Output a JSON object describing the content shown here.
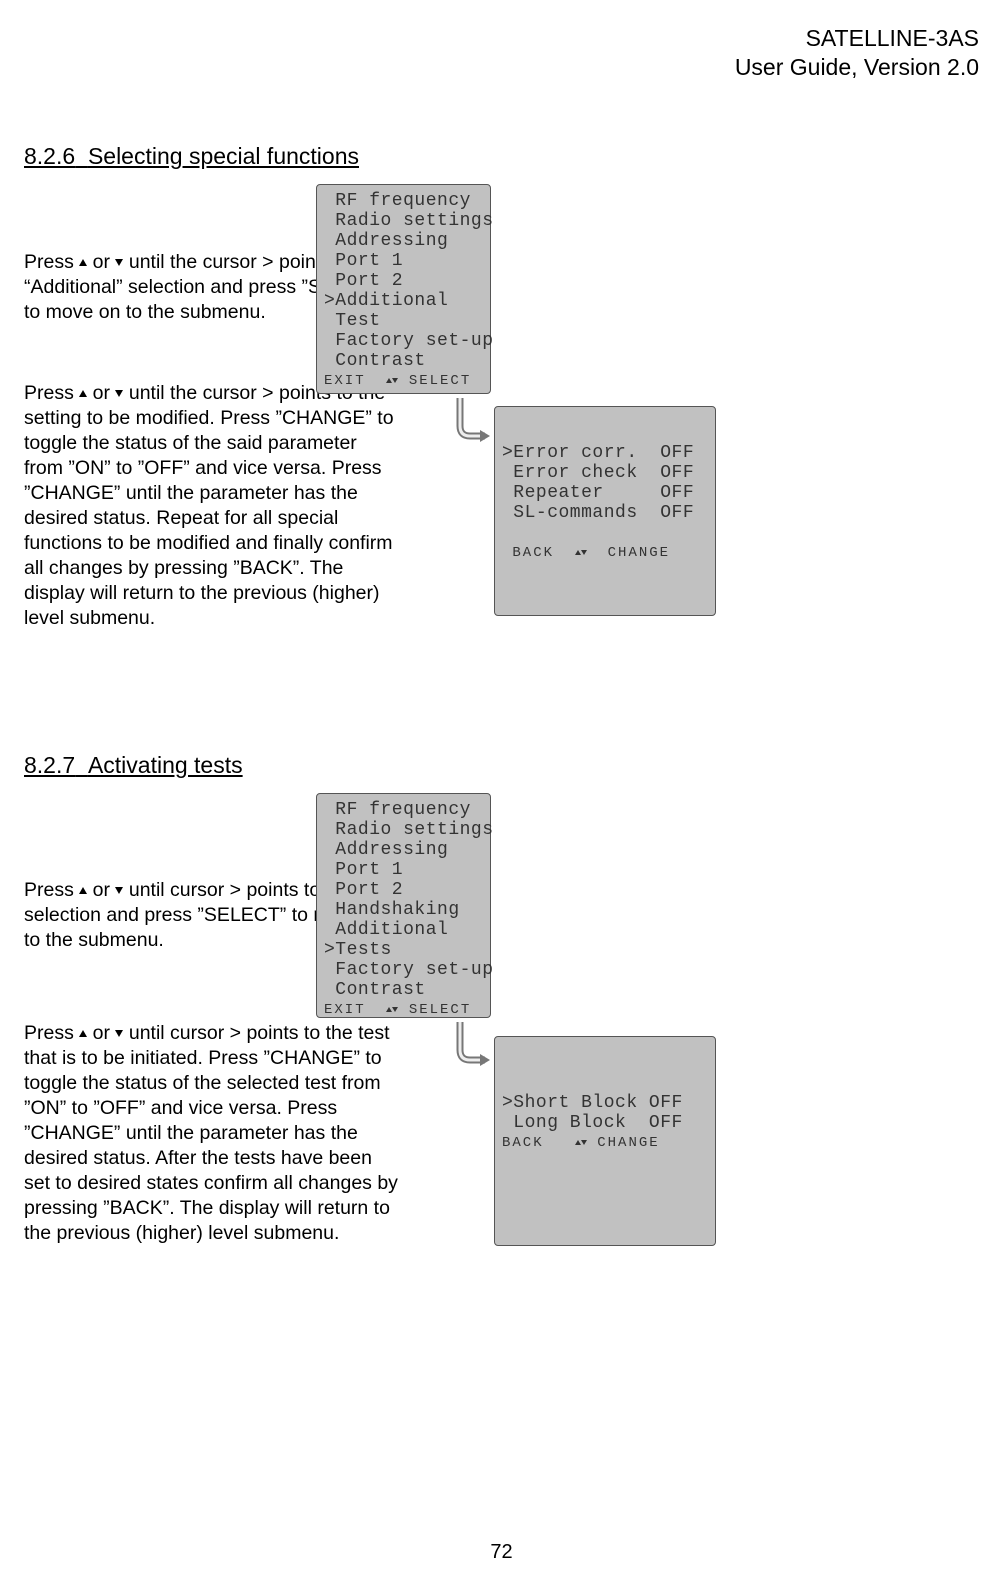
{
  "header": {
    "line1": "SATELLINE-3AS",
    "line2": "User Guide, Version 2.0"
  },
  "sections": {
    "s1": {
      "num": "8.2.6",
      "title": "Selecting special functions"
    },
    "s2": {
      "num": "8.2.7",
      "title": "Activating tests"
    }
  },
  "paragraphs": {
    "t1a": "Press ",
    "t1b": " or ",
    "t1c": " until the cursor > points to “Additional” selection and press ”SELECT” to move on to the submenu.",
    "t2a": "Press ",
    "t2b": " or ",
    "t2c": " until the cursor > points to the setting to be modified. Press ”CHANGE” to toggle the status of the said parameter from ”ON” to ”OFF” and vice versa. Press ”CHANGE” until the parameter has the desired status. Repeat for all special functions to be modified and finally confirm all changes by pressing ”BACK”. The display will return to the previous (higher) level submenu.",
    "t3a": "Press ",
    "t3b": " or ",
    "t3c": " until cursor > points to “Tests” selection and press ”SELECT” to move on to the submenu.",
    "t4a": "Press ",
    "t4b": " or ",
    "t4c": " until cursor > points to the test that is to be initiated. Press ”CHANGE” to toggle the status of the selected test from ”ON” to ”OFF” and vice versa. Press ”CHANGE” until the parameter has the desired status. After the tests have been set to desired states confirm all changes by pressing ”BACK”. The display will return to the previous (higher) level submenu."
  },
  "lcd1": {
    "l1": " RF frequency",
    "l2": " Radio settings",
    "l3": " Addressing",
    "l4": " Port 1",
    "l5": " Port 2",
    "l6": ">Additional",
    "l7": " Test",
    "l8": " Factory set-up",
    "l9": " Contrast",
    "footLeft": "EXIT",
    "footRight": "SELECT"
  },
  "lcd2": {
    "l1": ">Error corr.  OFF",
    "l2": " Error check  OFF",
    "l3": " Repeater     OFF",
    "l4": " SL-commands  OFF",
    "footLeft": "BACK",
    "footRight": "CHANGE"
  },
  "lcd3": {
    "l1": " RF frequency",
    "l2": " Radio settings",
    "l3": " Addressing",
    "l4": " Port 1",
    "l5": " Port 2",
    "l6": " Handshaking",
    "l7": " Additional",
    "l8": ">Tests",
    "l9": " Factory set-up",
    "l10": " Contrast",
    "footLeft": "EXIT",
    "footRight": "SELECT"
  },
  "lcd4": {
    "l1": ">Short Block OFF",
    "l2": " Long Block  OFF",
    "footLeft": "BACK",
    "footRight": "CHANGE"
  },
  "page_number": "72"
}
